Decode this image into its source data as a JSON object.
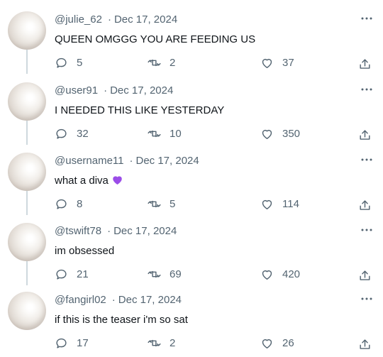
{
  "replies": [
    {
      "handle": "@julie_62",
      "date": "Dec 17, 2024",
      "text": "QUEEN OMGGG YOU ARE FEEDING US",
      "replies_count": "5",
      "retweets_count": "2",
      "likes_count": "37"
    },
    {
      "handle": "@user91",
      "date": "Dec 17, 2024",
      "text": "I NEEDED THIS LIKE YESTERDAY",
      "replies_count": "32",
      "retweets_count": "10",
      "likes_count": "350"
    },
    {
      "handle": "@username11",
      "date": "Dec 17, 2024",
      "text": "what a diva",
      "replies_count": "8",
      "retweets_count": "5",
      "likes_count": "114"
    },
    {
      "handle": "@tswift78",
      "date": "Dec 17, 2024",
      "text": "im obsessed",
      "replies_count": "21",
      "retweets_count": "69",
      "likes_count": "420"
    },
    {
      "handle": "@fangirl02",
      "date": "Dec 17, 2024",
      "text": "if this is the teaser i'm so sat",
      "replies_count": "17",
      "retweets_count": "2",
      "likes_count": "26"
    }
  ],
  "meta_separator": "·",
  "icons": {
    "reply": "reply-icon",
    "retweet": "retweet-icon",
    "like": "like-icon",
    "share": "share-icon",
    "more": "more-options-icon",
    "emoji": "purple-heart-emoji"
  },
  "colors": {
    "text": "#0f1419",
    "muted": "#536471",
    "thread_line": "#cfd9de",
    "emoji": "#9b4de8"
  }
}
